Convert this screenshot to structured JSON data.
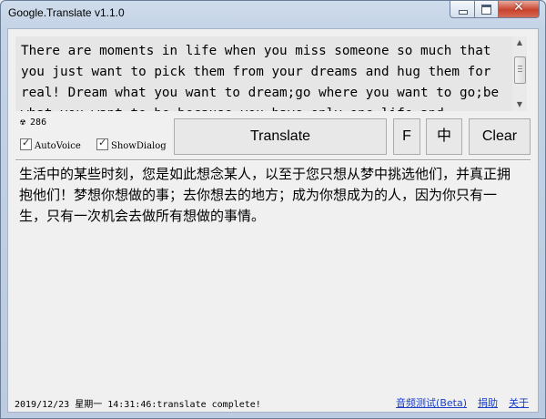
{
  "window": {
    "title": "Google.Translate v1.1.0",
    "close_glyph": "✕"
  },
  "source": {
    "text": "There are moments in life when you miss someone so much that you just want to pick them from your dreams and hug them for real! Dream what you want to dream;go where you want to go;be what you want to be,because you have only one life and"
  },
  "counter": {
    "icon": "radiation-icon",
    "icon_glyph": "☢",
    "value": "286"
  },
  "options": {
    "autovoice_label": "AutoVoice",
    "showdialog_label": "ShowDialog",
    "autovoice_checked": true,
    "showdialog_checked": true
  },
  "buttons": {
    "translate": "Translate",
    "f": "F",
    "zh": "中",
    "clear": "Clear"
  },
  "result": {
    "text": "生活中的某些时刻，您是如此想念某人，以至于您只想从梦中挑选他们，并真正拥抱他们！梦想你想做的事；去你想去的地方；成为你想成为的人，因为你只有一生，只有一次机会去做所有想做的事情。"
  },
  "status": {
    "text": "2019/12/23 星期一 14:31:46:translate complete!"
  },
  "links": {
    "audio_test": "音频测试(Beta)",
    "donate": "捐助",
    "about": "关于"
  }
}
